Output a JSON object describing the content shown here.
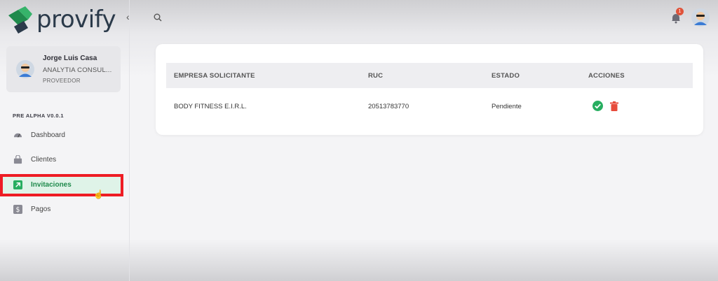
{
  "app": {
    "brand": "provify"
  },
  "user": {
    "name": "Jorge Luis Casa",
    "company": "ANALYTIA CONSUL...",
    "role": "PROVEEDOR"
  },
  "sidebar": {
    "version": "PRE ALPHA V0.0.1",
    "items": [
      {
        "label": "Dashboard",
        "icon": "dashboard-icon"
      },
      {
        "label": "Clientes",
        "icon": "bag-icon"
      },
      {
        "label": "Invitaciones",
        "icon": "arrow-up-right-icon",
        "active": true
      },
      {
        "label": "Pagos",
        "icon": "dollar-icon"
      }
    ]
  },
  "header": {
    "notifications_count": "1"
  },
  "table": {
    "columns": [
      "EMPRESA SOLICITANTE",
      "RUC",
      "ESTADO",
      "ACCIONES"
    ],
    "rows": [
      {
        "empresa": "BODY FITNESS E.I.R.L.",
        "ruc": "20513783770",
        "estado": "Pendiente"
      }
    ]
  },
  "colors": {
    "brand_green": "#1f8a4c",
    "accept": "#27ae60",
    "delete": "#e74c3c",
    "highlight": "#ee1c24"
  }
}
